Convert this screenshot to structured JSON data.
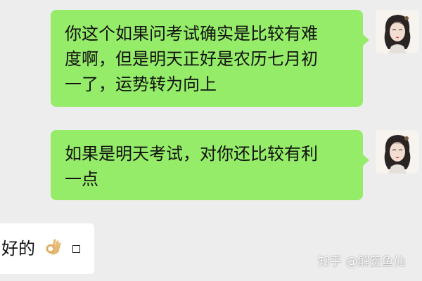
{
  "conversation": {
    "messages": [
      {
        "sender": "other",
        "bubble_color": "#95ec69",
        "lines": [
          "你这个如果问考试确实是比较有难",
          "度啊，但是明天正好是农历七月初",
          "一了，运势转为向上"
        ]
      },
      {
        "sender": "other",
        "bubble_color": "#95ec69",
        "lines": [
          "如果是明天考试，对你还比较有利",
          "一点"
        ]
      },
      {
        "sender": "self",
        "bubble_color": "#ffffff",
        "text": "好的",
        "emoji_icon": "ok-hand-icon",
        "trailing_icon": "box-icon"
      }
    ]
  },
  "background_color": "#ededed",
  "watermark": {
    "text": "知乎 @解签鱼仙"
  }
}
